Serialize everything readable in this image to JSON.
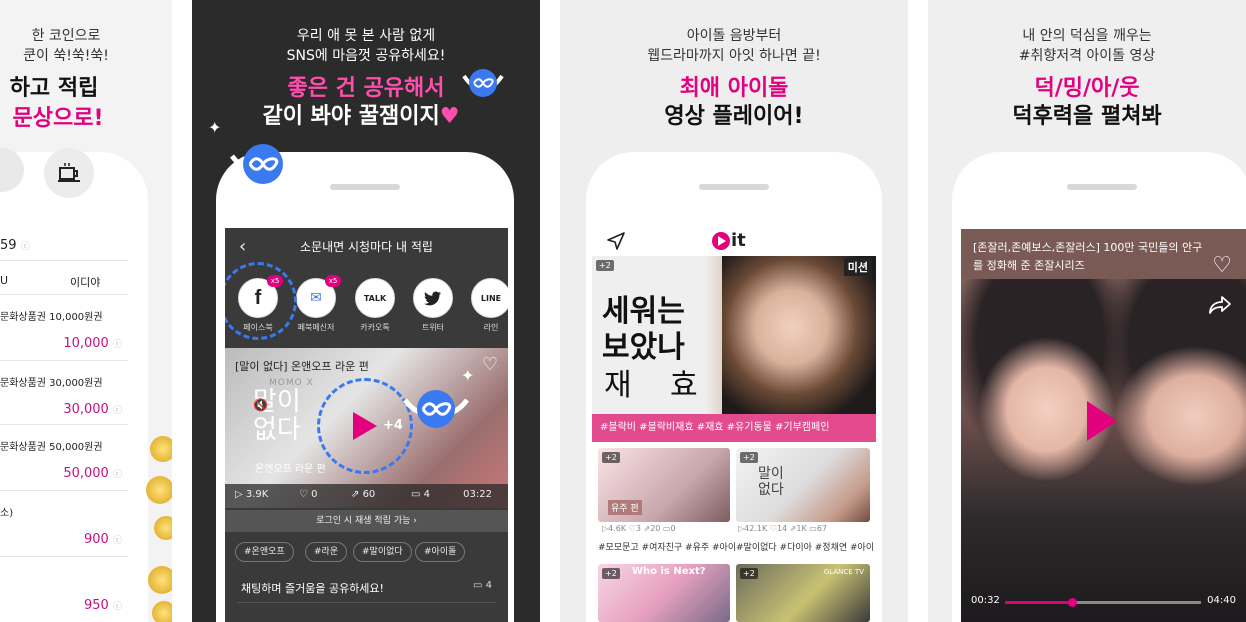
{
  "panel1": {
    "caption_line1": "한 코인으로",
    "caption_line2": "쿤이 쑥!쑥!쑥!",
    "headline1": "하고 적립",
    "headline2": "문상으로!",
    "balance": "59",
    "columns": [
      "U",
      "이디야"
    ],
    "items": [
      {
        "name": "문화상품권 10,000원권",
        "amount": "10,000"
      },
      {
        "name": "문화상품권 30,000원권",
        "amount": "30,000"
      },
      {
        "name": "문화상품권 50,000원권",
        "amount": "50,000"
      },
      {
        "name": "소)",
        "amount": "900"
      },
      {
        "name": "",
        "amount": "950"
      }
    ]
  },
  "panel2": {
    "caption_line1": "우리 애 못 본 사람 없게",
    "caption_line2": "SNS에 마음껏 공유하세요!",
    "headline1": "좋은 건 공유해서",
    "headline2": "같이 봐야 꿀잼이지",
    "screen_title": "소문내면 시청마다 내 적립",
    "share": [
      {
        "icon": "f",
        "label": "페이스북",
        "badge": "x5"
      },
      {
        "icon": "m",
        "label": "페북메신저",
        "badge": "x5"
      },
      {
        "icon": "TALK",
        "label": "카카오톡",
        "badge": ""
      },
      {
        "icon": "t",
        "label": "트위터",
        "badge": ""
      },
      {
        "icon": "LINE",
        "label": "라인",
        "badge": ""
      }
    ],
    "video_title": "[말이 없다] 온앤오프 라운 편",
    "brand": "MOMO X",
    "overlay_text": "말이 없다",
    "overlay_sub": "온앤오프 라운 편",
    "plus_count": "+4",
    "stats": {
      "plays": "3.9K",
      "likes": "0",
      "shares": "60",
      "comments": "4",
      "duration": "03:22"
    },
    "login_notice": "로그인 시 재생 적립 가능",
    "tags": [
      "#온앤오프",
      "#라운",
      "#말이없다",
      "#아이돌"
    ],
    "chat_prompt": "채팅하며 즐거움을 공유하세요!",
    "chat_count": "4"
  },
  "panel3": {
    "caption_line1": "아이돌 음방부터",
    "caption_line2": "웹드라마까지 아잇 하나면 끝!",
    "headline1": "최애 아이돌",
    "headline2": "영상 플레이어!",
    "logo": "it",
    "mission_badge": "미션",
    "feature_plus": "+2",
    "feature_text": [
      "세워는",
      "보았나",
      "재",
      "효"
    ],
    "feature_tags": "#블락비   #블락비재효   #재효   #유기동물   #기부캠페인",
    "thumbs": [
      {
        "plus": "+2",
        "stats": [
          "4.6K",
          "3",
          "20",
          "0"
        ],
        "tags": "#모모문고  #여자친구  #유주  #아이"
      },
      {
        "plus": "+2",
        "stats": [
          "42.1K",
          "14",
          "1K",
          "67"
        ],
        "tags": "#말이없다  #다이아  #정채연  #아이"
      },
      {
        "plus": "+2",
        "title": "Who is Next?"
      },
      {
        "plus": "+2",
        "title": "GLANCE TV"
      }
    ],
    "thumb1_label": "유주 편",
    "thumb2_label": "말이 없다"
  },
  "panel4": {
    "caption_line1": "내 안의 덕심을 깨우는",
    "caption_line2": "#취향저격 아이돌 영상",
    "headline1": "덕/밍/아/웃",
    "headline2": "덕후력을 펼쳐봐",
    "video_title": "[존잘러,존예보스,존잘러스] 100만 국민들의 안구를 정화해 준 존잘시리즈",
    "time_current": "00:32",
    "time_total": "04:40",
    "progress": 0.34
  },
  "colors": {
    "accent": "#e3007f",
    "hashbar": "#e34b8e",
    "badge_blue": "#3b79f0"
  }
}
